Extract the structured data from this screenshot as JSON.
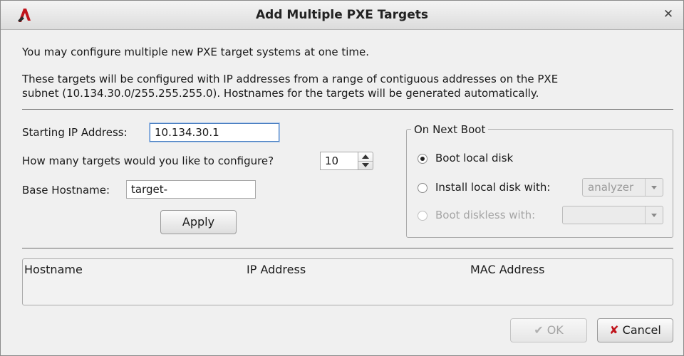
{
  "window": {
    "title": "Add Multiple PXE Targets"
  },
  "intro": {
    "line1": "You may configure multiple new PXE target systems at one time.",
    "line2": "These targets will be configured with IP addresses from a range of contiguous addresses on the PXE",
    "line3": "subnet (10.134.30.0/255.255.255.0).  Hostnames for the targets will be generated automatically."
  },
  "form": {
    "starting_ip_label": "Starting IP Address:",
    "starting_ip_value": "10.134.30.1",
    "count_label": "How many targets would you like to configure?",
    "count_value": "10",
    "hostname_label": "Base Hostname:",
    "hostname_value": "target-",
    "apply_label": "Apply"
  },
  "next_boot": {
    "title": "On Next Boot",
    "option_local": "Boot local disk",
    "option_install": "Install local disk with:",
    "install_combo_value": "analyzer",
    "option_diskless": "Boot diskless with:",
    "selected": "Boot local disk"
  },
  "table": {
    "columns": [
      "Hostname",
      "IP Address",
      "MAC Address"
    ]
  },
  "buttons": {
    "ok": "OK",
    "cancel": "Cancel"
  }
}
